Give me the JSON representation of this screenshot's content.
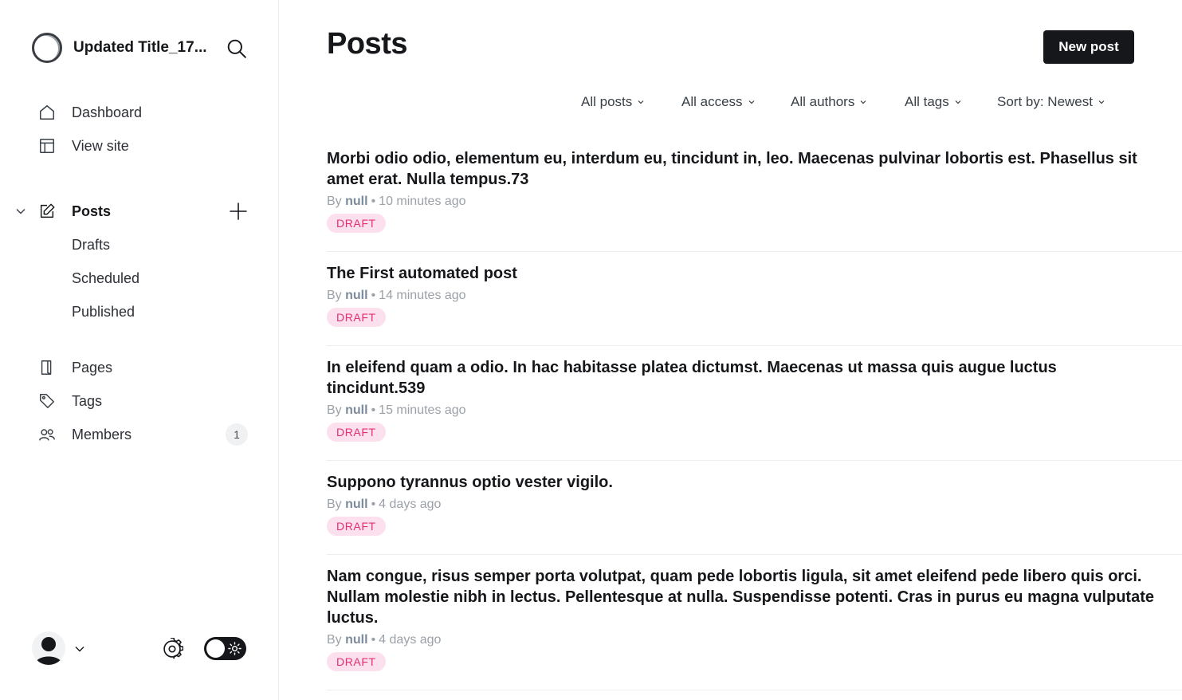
{
  "sidebar": {
    "site_title": "Updated Title_17...",
    "nav": {
      "dashboard": "Dashboard",
      "view_site": "View site",
      "posts": "Posts",
      "drafts": "Drafts",
      "scheduled": "Scheduled",
      "published": "Published",
      "pages": "Pages",
      "tags": "Tags",
      "members": "Members",
      "members_count": "1"
    }
  },
  "header": {
    "title": "Posts",
    "new_post_label": "New post"
  },
  "filters": {
    "type": "All posts",
    "access": "All access",
    "authors": "All authors",
    "tags": "All tags",
    "sort": "Sort by: Newest"
  },
  "posts": [
    {
      "title": "Morbi odio odio, elementum eu, interdum eu, tincidunt in, leo. Maecenas pulvinar lobortis est. Phasellus sit amet erat. Nulla tempus.73",
      "by": "By",
      "author": "null",
      "time": "10 minutes ago",
      "status": "DRAFT"
    },
    {
      "title": "The First automated post",
      "by": "By",
      "author": "null",
      "time": "14 minutes ago",
      "status": "DRAFT"
    },
    {
      "title": "In eleifend quam a odio. In hac habitasse platea dictumst. Maecenas ut massa quis augue luctus tincidunt.539",
      "by": "By",
      "author": "null",
      "time": "15 minutes ago",
      "status": "DRAFT"
    },
    {
      "title": "Suppono tyrannus optio vester vigilo.",
      "by": "By",
      "author": "null",
      "time": "4 days ago",
      "status": "DRAFT"
    },
    {
      "title": "Nam congue, risus semper porta volutpat, quam pede lobortis ligula, sit amet eleifend pede libero quis orci. Nullam molestie nibh in lectus. Pellentesque at nulla. Suspendisse potenti. Cras in purus eu magna vulputate luctus.",
      "by": "By",
      "author": "null",
      "time": "4 days ago",
      "status": "DRAFT"
    }
  ],
  "colors": {
    "accent_dark": "#15171a",
    "draft_bg": "#fde0ee",
    "draft_text": "#e4306d",
    "muted": "#9ba1a8"
  }
}
